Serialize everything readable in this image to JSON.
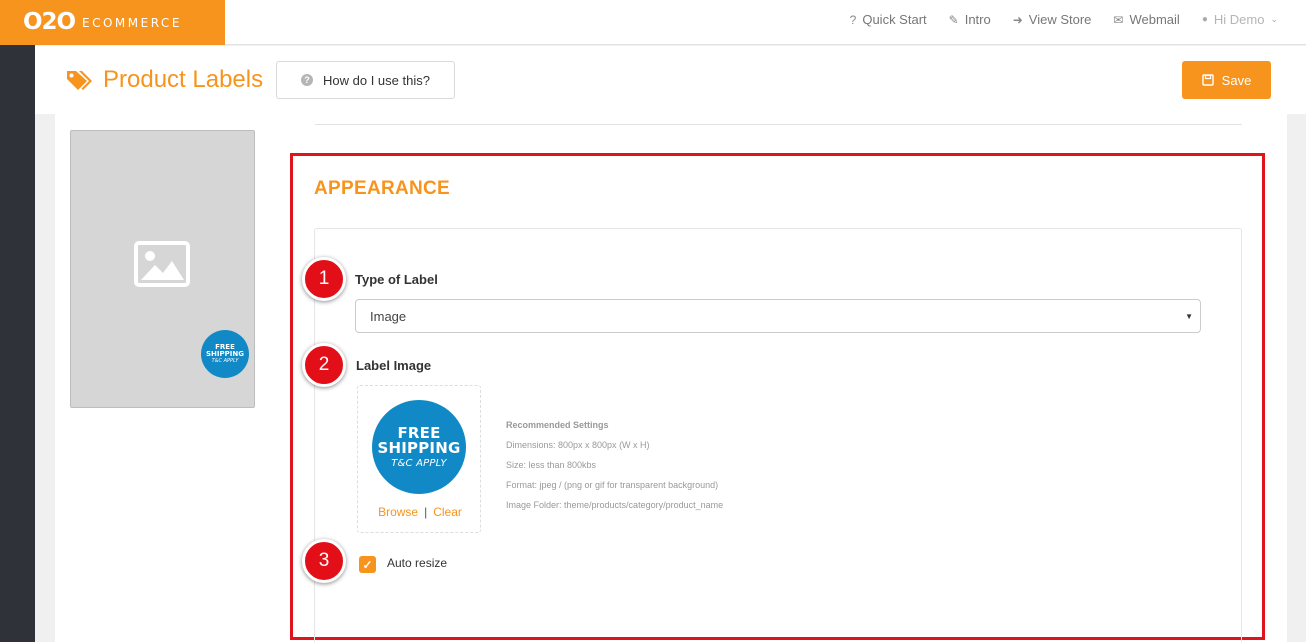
{
  "brand": {
    "logo": "O2O",
    "tagline": "ECOMMERCE",
    "accent": "#f7941d"
  },
  "topnav": [
    {
      "label": "Quick Start",
      "icon": "question-icon",
      "glyph": "?"
    },
    {
      "label": "Intro",
      "icon": "wand-icon",
      "glyph": "✎"
    },
    {
      "label": "View Store",
      "icon": "sign-in-icon",
      "glyph": "➜"
    },
    {
      "label": "Webmail",
      "icon": "envelope-icon",
      "glyph": "✉"
    },
    {
      "label": "Hi Demo",
      "icon": "user-icon",
      "glyph": "●"
    }
  ],
  "header": {
    "title": "Product Labels",
    "help_label": "How do I use this?",
    "save_label": "Save"
  },
  "preview": {
    "badge_line1": "FREE",
    "badge_line2": "SHIPPING",
    "badge_line3": "T&C APPLY"
  },
  "appearance": {
    "section_title": "APPEARANCE",
    "steps": [
      "1",
      "2",
      "3"
    ],
    "type_label": "Type of Label",
    "type_value": "Image",
    "image_label": "Label Image",
    "browse_label": "Browse",
    "separator": "|",
    "clear_label": "Clear",
    "recommended": {
      "title": "Recommended Settings",
      "dimensions": "Dimensions: 800px x 800px (W x H)",
      "size": "Size: less than 800kbs",
      "format": "Format: jpeg / (png or gif for transparent background)",
      "folder": "Image Folder: theme/products/category/product_name"
    },
    "auto_resize_label": "Auto resize",
    "auto_resize_checked": true
  },
  "colors": {
    "accent": "#f7941d",
    "highlight": "#e0141b",
    "badge": "#1189c6",
    "rail": "#2f3238"
  }
}
